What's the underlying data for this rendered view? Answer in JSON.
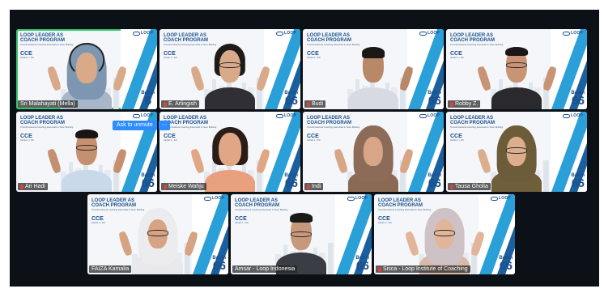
{
  "window": {
    "title": ""
  },
  "background": {
    "program_title": "LOOP LEADER AS\nCOACH PROGRAM",
    "tagline": "Transformational Coaching Essentials & Team Building",
    "cce": "CCE",
    "cce_sub": "LEVEL 1 / ICF",
    "logo_text": "LOOP",
    "batch_label": "Batch",
    "batch_number": "66"
  },
  "unmute": {
    "label": "Ask to unmute",
    "more_label": "···"
  },
  "participants": [
    {
      "name": "Sri Malahayati (Mella)",
      "mic_muted": false,
      "active": true,
      "batch_number": "6"
    },
    {
      "name": "E. Arlingish",
      "mic_muted": true
    },
    {
      "name": "Budi",
      "mic_muted": true
    },
    {
      "name": "Robby Z.",
      "mic_muted": true
    },
    {
      "name": "Ari Hadi",
      "mic_muted": true
    },
    {
      "name": "Meiske Wahju",
      "mic_muted": true
    },
    {
      "name": "Indi",
      "mic_muted": true
    },
    {
      "name": "Tausa Gholia",
      "mic_muted": true
    },
    {
      "name": "FAIZA Kamalia",
      "mic_muted": false
    },
    {
      "name": "Amsar - Loop Indonesia",
      "mic_muted": false
    },
    {
      "name": "Sisca - Loop Institute of Coaching",
      "mic_muted": true
    }
  ],
  "colors": {
    "accent_blue": "#2a9fd8",
    "brand_navy": "#1a4f8c",
    "active_speaker": "#36c46a",
    "muted_mic": "#e0413d",
    "unmute_button": "#2d8cff"
  }
}
